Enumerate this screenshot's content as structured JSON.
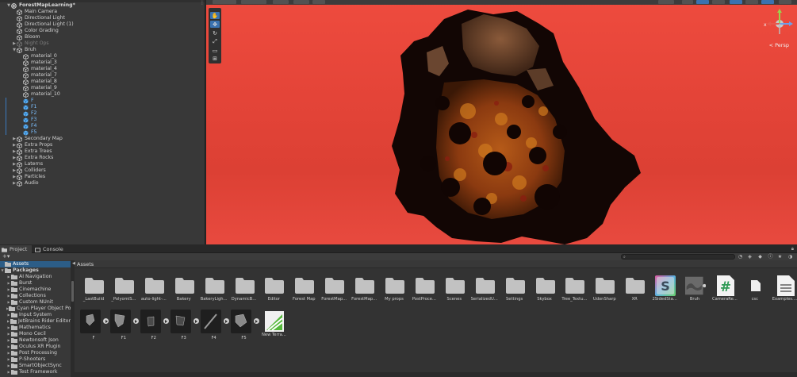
{
  "hierarchy": {
    "scene_name": "ForestMapLearning*",
    "rows": [
      {
        "label": "Main Camera",
        "style": "normal",
        "arrow": ""
      },
      {
        "label": "Directional Light",
        "style": "normal",
        "arrow": ""
      },
      {
        "label": "Directional Light (1)",
        "style": "normal",
        "arrow": ""
      },
      {
        "label": "Color Grading",
        "style": "normal",
        "arrow": ""
      },
      {
        "label": "Bloom",
        "style": "normal",
        "arrow": ""
      },
      {
        "label": "Night Ops",
        "style": "dim",
        "arrow": "▶"
      },
      {
        "label": "Bruh",
        "style": "normal",
        "arrow": "▼"
      },
      {
        "label": "material_0",
        "style": "normal",
        "arrow": ""
      },
      {
        "label": "material_3",
        "style": "normal",
        "arrow": ""
      },
      {
        "label": "material_4",
        "style": "normal",
        "arrow": ""
      },
      {
        "label": "material_7",
        "style": "normal",
        "arrow": ""
      },
      {
        "label": "material_8",
        "style": "normal",
        "arrow": ""
      },
      {
        "label": "material_9",
        "style": "normal",
        "arrow": ""
      },
      {
        "label": "material_10",
        "style": "normal",
        "arrow": ""
      },
      {
        "label": "F",
        "style": "blue",
        "arrow": ""
      },
      {
        "label": "F1",
        "style": "blue",
        "arrow": ""
      },
      {
        "label": "F2",
        "style": "blue",
        "arrow": ""
      },
      {
        "label": "F3",
        "style": "blue",
        "arrow": ""
      },
      {
        "label": "F4",
        "style": "blue",
        "arrow": ""
      },
      {
        "label": "F5",
        "style": "blue",
        "arrow": ""
      },
      {
        "label": "Secondary Map",
        "style": "normal",
        "arrow": "▶"
      },
      {
        "label": "Extra Props",
        "style": "normal",
        "arrow": "▶"
      },
      {
        "label": "Extra Trees",
        "style": "normal",
        "arrow": "▶"
      },
      {
        "label": "Extra Rocks",
        "style": "normal",
        "arrow": "▶"
      },
      {
        "label": "Laterns",
        "style": "normal",
        "arrow": "▶"
      },
      {
        "label": "Colliders",
        "style": "normal",
        "arrow": "▶"
      },
      {
        "label": "Particles",
        "style": "normal",
        "arrow": "▶"
      },
      {
        "label": "Audio",
        "style": "normal",
        "arrow": "▶"
      }
    ]
  },
  "scene_view": {
    "persp_label": "< Persp",
    "gizmo_axis": "x",
    "sky_color": "#e64538"
  },
  "tabs": {
    "project": "Project",
    "console": "Console"
  },
  "folder_tree": {
    "rows": [
      {
        "label": "Assets",
        "selected": true,
        "bold": false,
        "indent": 0,
        "arrow": ""
      },
      {
        "label": "Packages",
        "selected": false,
        "bold": true,
        "indent": 0,
        "arrow": "▼"
      },
      {
        "label": "AI Navigation",
        "indent": 1,
        "arrow": "▶"
      },
      {
        "label": "Burst",
        "indent": 1,
        "arrow": "▶"
      },
      {
        "label": "Cinemachine",
        "indent": 1,
        "arrow": "▶"
      },
      {
        "label": "Collections",
        "indent": 1,
        "arrow": "▶"
      },
      {
        "label": "Custom NUnit",
        "indent": 1,
        "arrow": "▶"
      },
      {
        "label": "Cyan Player Object Pool",
        "indent": 1,
        "arrow": "▶"
      },
      {
        "label": "Input System",
        "indent": 1,
        "arrow": "▶"
      },
      {
        "label": "JetBrains Rider Editor",
        "indent": 1,
        "arrow": "▶"
      },
      {
        "label": "Mathematics",
        "indent": 1,
        "arrow": "▶"
      },
      {
        "label": "Mono Cecil",
        "indent": 1,
        "arrow": "▶"
      },
      {
        "label": "Newtonsoft Json",
        "indent": 1,
        "arrow": "▶"
      },
      {
        "label": "Oculus XR Plugin",
        "indent": 1,
        "arrow": "▶"
      },
      {
        "label": "Post Processing",
        "indent": 1,
        "arrow": "▶"
      },
      {
        "label": "P-Shooters",
        "indent": 1,
        "arrow": "▶"
      },
      {
        "label": "SmartObjectSync",
        "indent": 1,
        "arrow": "▶"
      },
      {
        "label": "Test Framework",
        "indent": 1,
        "arrow": "▶"
      }
    ]
  },
  "assets": {
    "header": "Assets",
    "row1": [
      {
        "name": "_LastBuild",
        "kind": "folder"
      },
      {
        "name": "_PolyomiS...",
        "kind": "folder"
      },
      {
        "name": "auto-light-...",
        "kind": "folder"
      },
      {
        "name": "Bakery",
        "kind": "folder"
      },
      {
        "name": "BakeryLigh...",
        "kind": "folder"
      },
      {
        "name": "DynamicB...",
        "kind": "folder"
      },
      {
        "name": "Editor",
        "kind": "folder"
      },
      {
        "name": "Forest Map",
        "kind": "folder"
      },
      {
        "name": "ForestMap...",
        "kind": "folder"
      },
      {
        "name": "ForestMap...",
        "kind": "folder"
      },
      {
        "name": "My props",
        "kind": "folder"
      },
      {
        "name": "PostProce...",
        "kind": "folder"
      },
      {
        "name": "Scenes",
        "kind": "folder"
      },
      {
        "name": "SerializedU...",
        "kind": "folder"
      },
      {
        "name": "Settings",
        "kind": "folder"
      },
      {
        "name": "Skybox",
        "kind": "folder"
      },
      {
        "name": "Tree_Textu...",
        "kind": "folder"
      },
      {
        "name": "UdonSharp",
        "kind": "folder"
      },
      {
        "name": "XR",
        "kind": "folder"
      },
      {
        "name": "2SidedSta...",
        "kind": "shader"
      },
      {
        "name": "Bruh",
        "kind": "model"
      },
      {
        "name": "CameraRe...",
        "kind": "csharp"
      },
      {
        "name": "csc",
        "kind": "file"
      },
      {
        "name": "Examples....",
        "kind": "doc"
      }
    ],
    "row2": [
      {
        "name": "F",
        "kind": "prefab"
      },
      {
        "name": "F1",
        "kind": "prefab"
      },
      {
        "name": "F2",
        "kind": "prefab"
      },
      {
        "name": "F3",
        "kind": "prefab"
      },
      {
        "name": "F4",
        "kind": "prefab"
      },
      {
        "name": "F5",
        "kind": "prefab"
      },
      {
        "name": "New Terra...",
        "kind": "terrain"
      }
    ]
  }
}
